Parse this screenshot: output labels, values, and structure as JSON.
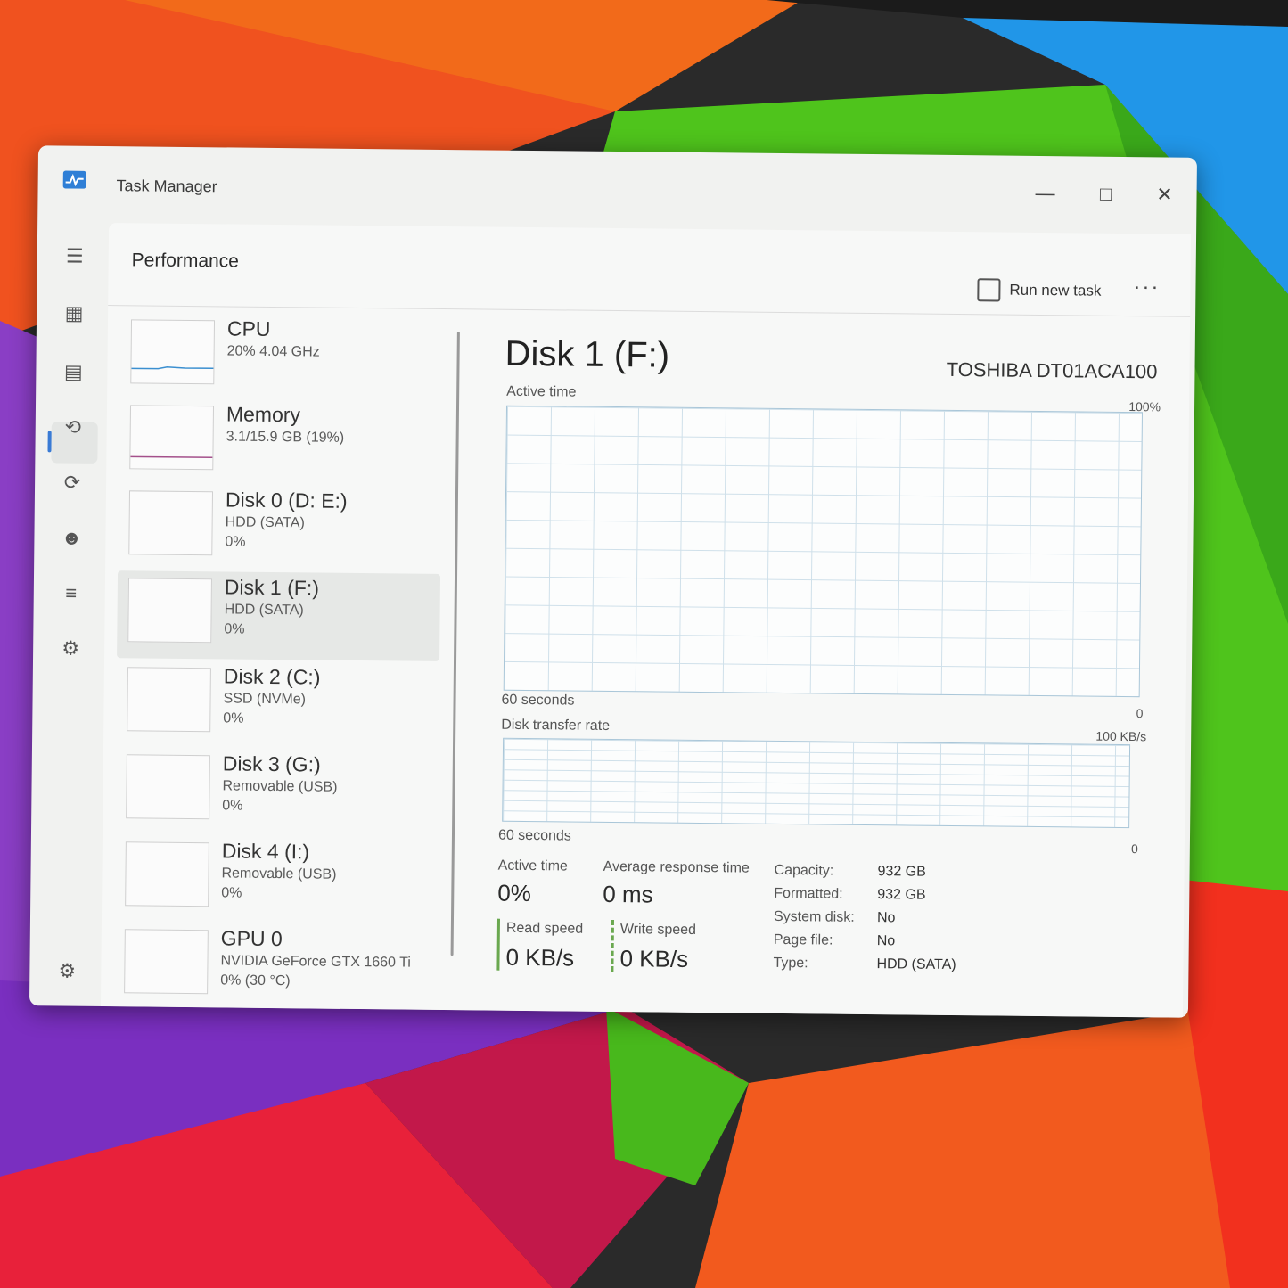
{
  "window": {
    "title": "Task Manager"
  },
  "page": {
    "title": "Performance",
    "run_new_task": "Run new task",
    "more": "···"
  },
  "devices": [
    {
      "name": "CPU",
      "sub": "20% 4.04 GHz",
      "sub2": ""
    },
    {
      "name": "Memory",
      "sub": "3.1/15.9 GB (19%)",
      "sub2": ""
    },
    {
      "name": "Disk 0 (D: E:)",
      "sub": "HDD (SATA)",
      "sub2": "0%"
    },
    {
      "name": "Disk 1 (F:)",
      "sub": "HDD (SATA)",
      "sub2": "0%"
    },
    {
      "name": "Disk 2 (C:)",
      "sub": "SSD (NVMe)",
      "sub2": "0%"
    },
    {
      "name": "Disk 3 (G:)",
      "sub": "Removable (USB)",
      "sub2": "0%"
    },
    {
      "name": "Disk 4 (I:)",
      "sub": "Removable (USB)",
      "sub2": "0%"
    },
    {
      "name": "GPU 0",
      "sub": "NVIDIA GeForce GTX 1660 Ti",
      "sub2": "0% (30 °C)"
    }
  ],
  "detail": {
    "title": "Disk 1 (F:)",
    "model": "TOSHIBA DT01ACA100",
    "graph1": {
      "label": "Active time",
      "max": "100%",
      "time": "60 seconds",
      "min": "0"
    },
    "graph2": {
      "label": "Disk transfer rate",
      "max": "100 KB/s",
      "time": "60 seconds",
      "min": "0"
    },
    "stats": {
      "active_time_label": "Active time",
      "active_time": "0%",
      "avg_response_label": "Average response time",
      "avg_response": "0 ms",
      "read_label": "Read speed",
      "read": "0 KB/s",
      "write_label": "Write speed",
      "write": "0 KB/s"
    },
    "props": [
      {
        "k": "Capacity:",
        "v": "932 GB"
      },
      {
        "k": "Formatted:",
        "v": "932 GB"
      },
      {
        "k": "System disk:",
        "v": "No"
      },
      {
        "k": "Page file:",
        "v": "No"
      },
      {
        "k": "Type:",
        "v": "HDD (SATA)"
      }
    ]
  },
  "colors": {
    "accent": "#3a7bd5",
    "cpu_line": "#3b8fd0",
    "memory_line": "#a4508b",
    "disk_line": "#6aa84f"
  },
  "icons": [
    "hamburger-icon",
    "processes-icon",
    "performance-icon",
    "app-history-icon",
    "startup-apps-icon",
    "users-icon",
    "details-icon",
    "services-icon",
    "settings-icon"
  ]
}
